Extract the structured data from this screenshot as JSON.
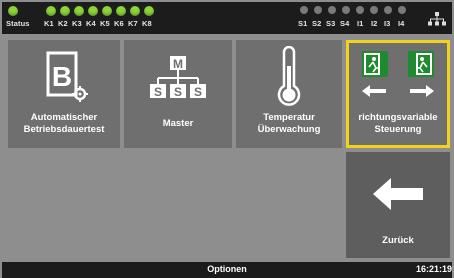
{
  "status_bar": {
    "status_label": "Status",
    "k_channels": [
      "K1",
      "K2",
      "K3",
      "K4",
      "K5",
      "K6",
      "K7",
      "K8"
    ],
    "s_inputs": [
      "S1",
      "S2",
      "S3",
      "S4",
      "I1",
      "I2",
      "I3",
      "I4"
    ],
    "active_color": "#8dd43a",
    "inactive_color": "#7a7a7a",
    "network_icon": "network-icon"
  },
  "tiles": [
    {
      "label_line1": "Automatischer",
      "label_line2": "Betriebsdauertest",
      "icon": "battery-test-icon"
    },
    {
      "label_line1": "Master",
      "label_line2": "",
      "icon": "master-hierarchy-icon"
    },
    {
      "label_line1": "Temperatur",
      "label_line2": "Überwachung",
      "icon": "thermometer-icon"
    },
    {
      "label_line1": "richtungsvariable",
      "label_line2": "Steuerung",
      "icon": "exit-direction-icon"
    }
  ],
  "master_icon_letters": {
    "top": "M",
    "bottom": [
      "S",
      "S",
      "S"
    ]
  },
  "battery_icon_letter": "B",
  "back": {
    "label": "Zurück",
    "icon": "arrow-left-icon"
  },
  "bottom_bar": {
    "options_label": "Optionen",
    "time": "16:21:19"
  },
  "accent_color": "#f1d21c"
}
